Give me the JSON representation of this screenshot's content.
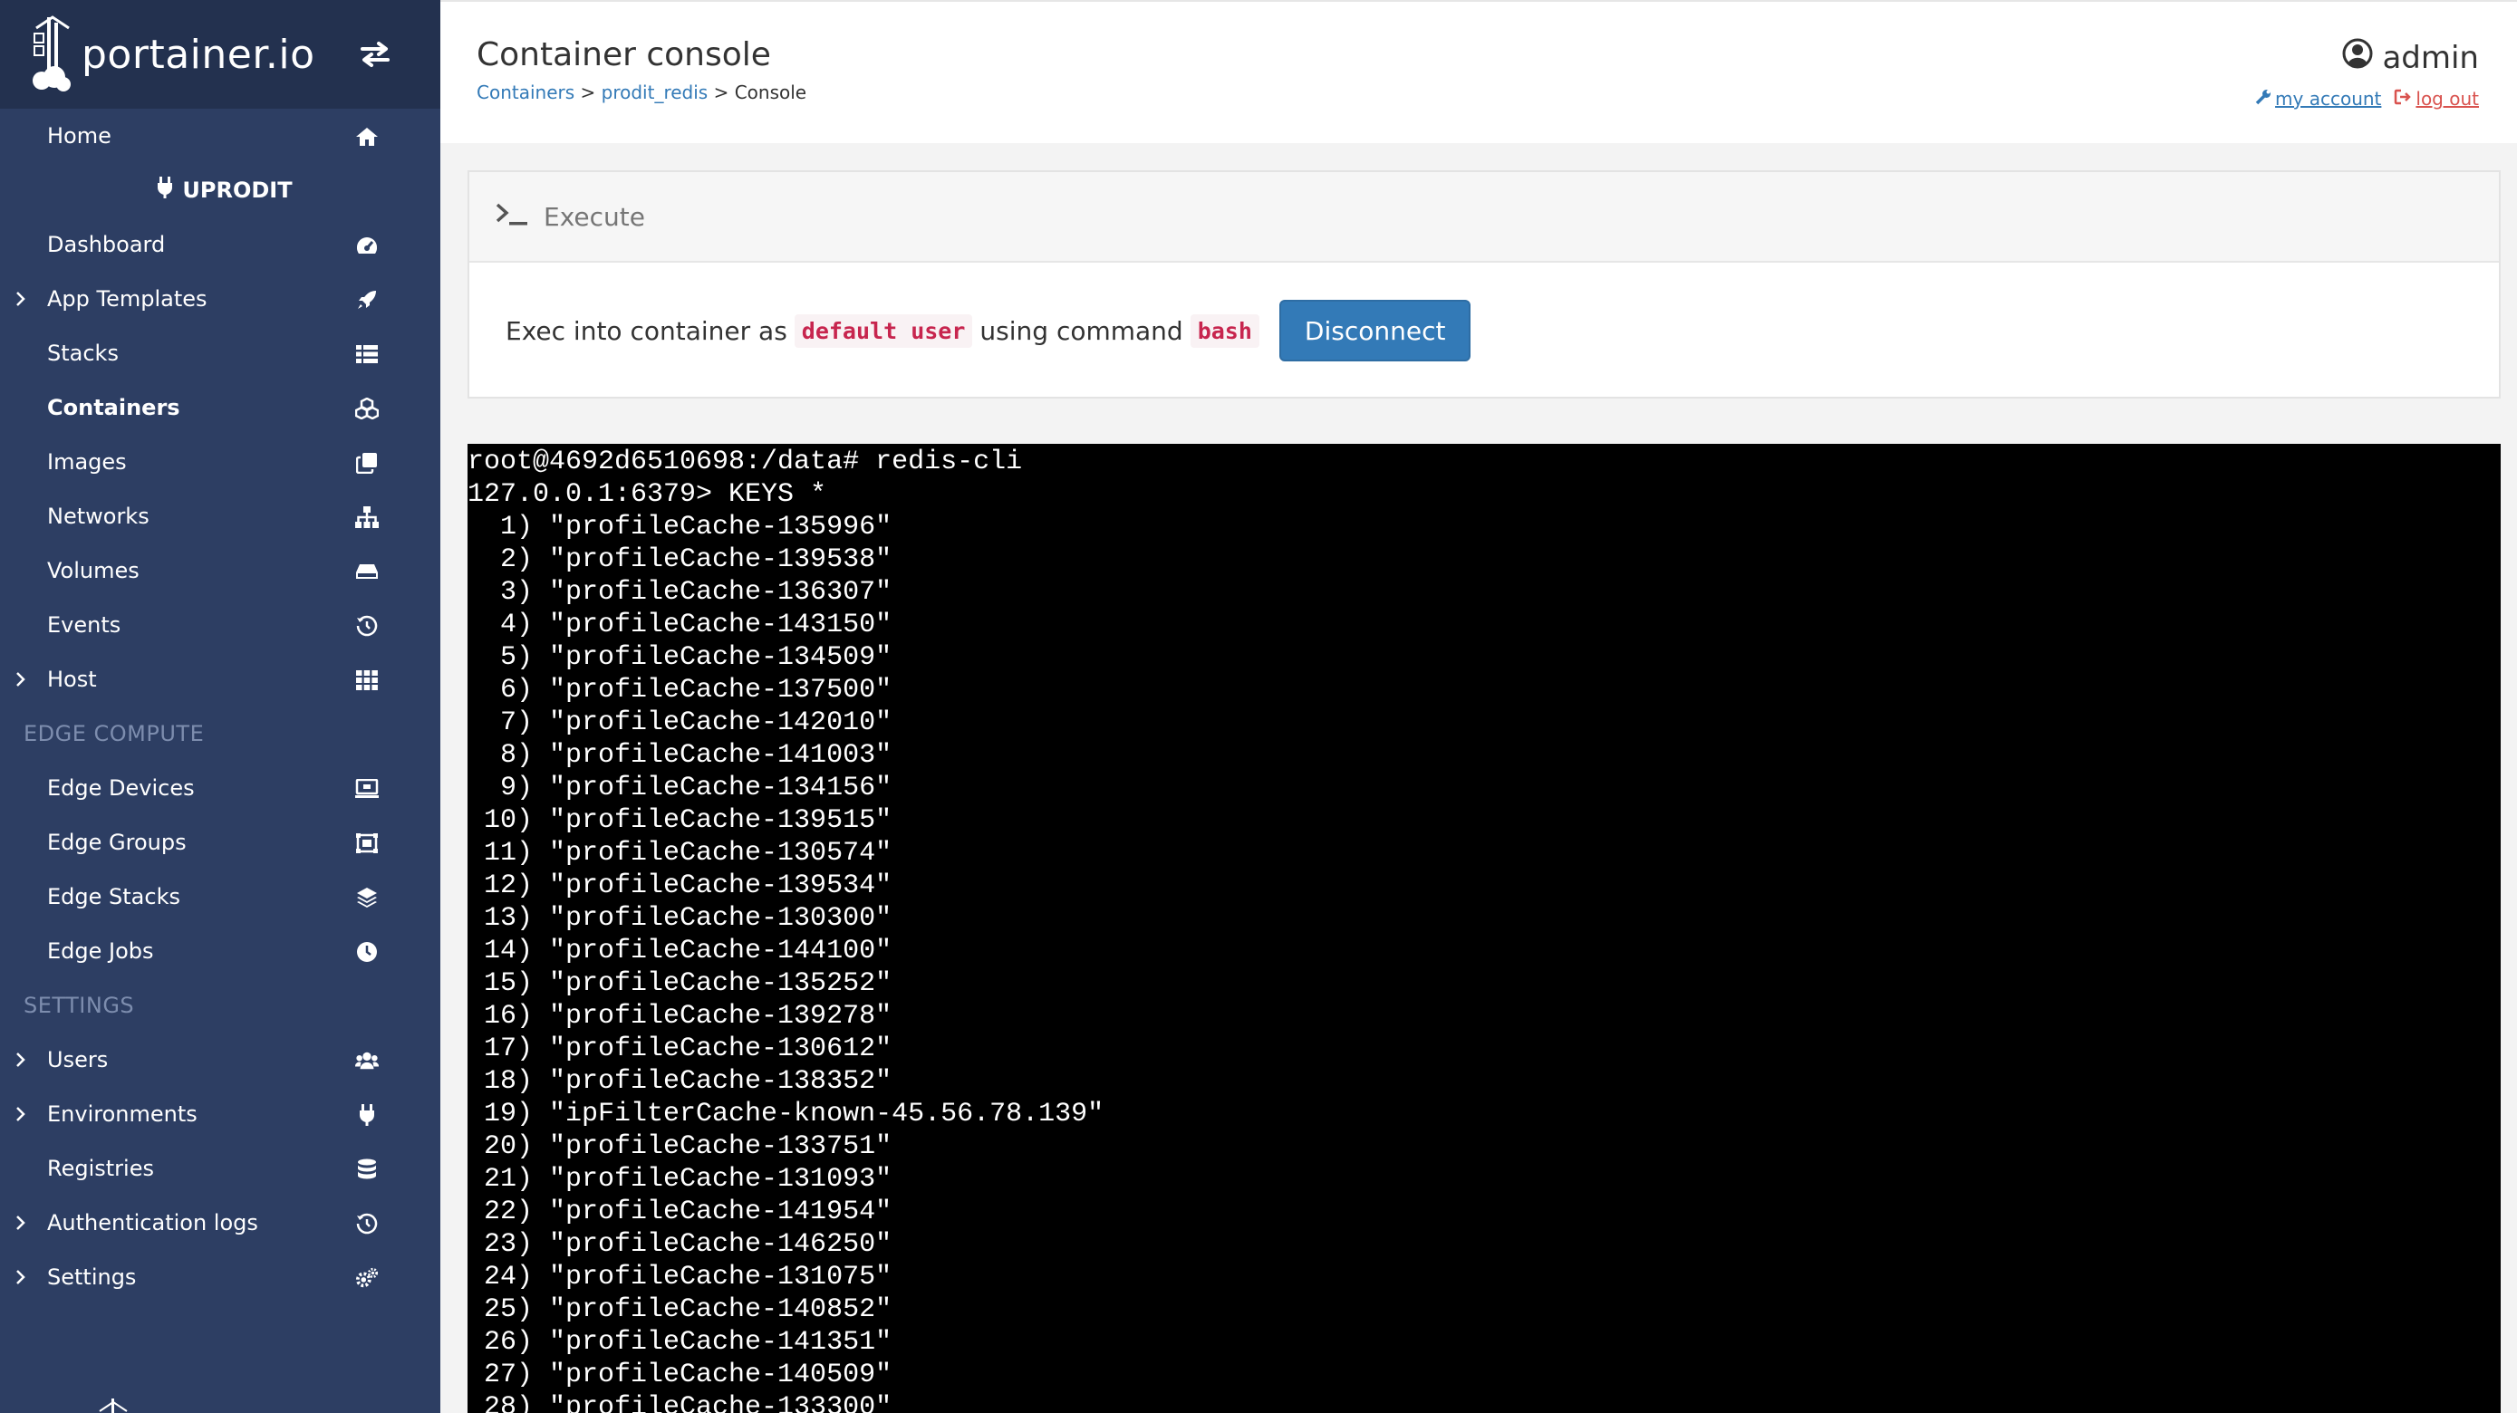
{
  "brand": {
    "name": "portainer.io"
  },
  "sidebar": {
    "home_label": "Home",
    "environment_name": "UPRODIT",
    "env_items": [
      {
        "label": "Dashboard",
        "icon": "tachometer-icon",
        "expandable": false
      },
      {
        "label": "App Templates",
        "icon": "rocket-icon",
        "expandable": true
      },
      {
        "label": "Stacks",
        "icon": "th-list-icon",
        "expandable": false
      },
      {
        "label": "Containers",
        "icon": "cubes-icon",
        "expandable": false,
        "active": true
      },
      {
        "label": "Images",
        "icon": "clone-icon",
        "expandable": false
      },
      {
        "label": "Networks",
        "icon": "sitemap-icon",
        "expandable": false
      },
      {
        "label": "Volumes",
        "icon": "hdd-icon",
        "expandable": false
      },
      {
        "label": "Events",
        "icon": "history-icon",
        "expandable": false
      },
      {
        "label": "Host",
        "icon": "th-icon",
        "expandable": true
      }
    ],
    "edge_title": "EDGE COMPUTE",
    "edge_items": [
      {
        "label": "Edge Devices",
        "icon": "laptop-icon"
      },
      {
        "label": "Edge Groups",
        "icon": "object-group-icon"
      },
      {
        "label": "Edge Stacks",
        "icon": "layer-group-icon"
      },
      {
        "label": "Edge Jobs",
        "icon": "clock-icon"
      }
    ],
    "settings_title": "SETTINGS",
    "settings_items": [
      {
        "label": "Users",
        "icon": "users-icon",
        "expandable": true
      },
      {
        "label": "Environments",
        "icon": "plug-icon",
        "expandable": true
      },
      {
        "label": "Registries",
        "icon": "database-icon",
        "expandable": false
      },
      {
        "label": "Authentication logs",
        "icon": "history-icon",
        "expandable": true
      },
      {
        "label": "Settings",
        "icon": "cogs-icon",
        "expandable": true
      }
    ]
  },
  "header": {
    "title": "Container console",
    "breadcrumb": {
      "containers": "Containers",
      "container": "prodit_redis",
      "current": "Console",
      "sep": ">"
    },
    "user": {
      "name": "admin",
      "my_account": "my account",
      "log_out": "log out"
    }
  },
  "execute": {
    "title": "Execute",
    "text_before": "Exec into container as",
    "user_value": "default user",
    "text_middle": "using command",
    "command_value": "bash",
    "disconnect_label": "Disconnect"
  },
  "terminal": {
    "lines": [
      "root@4692d6510698:/data# redis-cli",
      "127.0.0.1:6379> KEYS *",
      "  1) \"profileCache-135996\"",
      "  2) \"profileCache-139538\"",
      "  3) \"profileCache-136307\"",
      "  4) \"profileCache-143150\"",
      "  5) \"profileCache-134509\"",
      "  6) \"profileCache-137500\"",
      "  7) \"profileCache-142010\"",
      "  8) \"profileCache-141003\"",
      "  9) \"profileCache-134156\"",
      " 10) \"profileCache-139515\"",
      " 11) \"profileCache-130574\"",
      " 12) \"profileCache-139534\"",
      " 13) \"profileCache-130300\"",
      " 14) \"profileCache-144100\"",
      " 15) \"profileCache-135252\"",
      " 16) \"profileCache-139278\"",
      " 17) \"profileCache-130612\"",
      " 18) \"profileCache-138352\"",
      " 19) \"ipFilterCache-known-45.56.78.139\"",
      " 20) \"profileCache-133751\"",
      " 21) \"profileCache-131093\"",
      " 22) \"profileCache-141954\"",
      " 23) \"profileCache-146250\"",
      " 24) \"profileCache-131075\"",
      " 25) \"profileCache-140852\"",
      " 26) \"profileCache-141351\"",
      " 27) \"profileCache-140509\"",
      " 28) \"profileCache-133300\""
    ]
  },
  "colors": {
    "sidebar_bg": "#2d3e63",
    "brand_bg": "#23314f",
    "link": "#337ab7",
    "danger": "#d9534f",
    "code": "#c7254e",
    "button": "#337ab7"
  }
}
